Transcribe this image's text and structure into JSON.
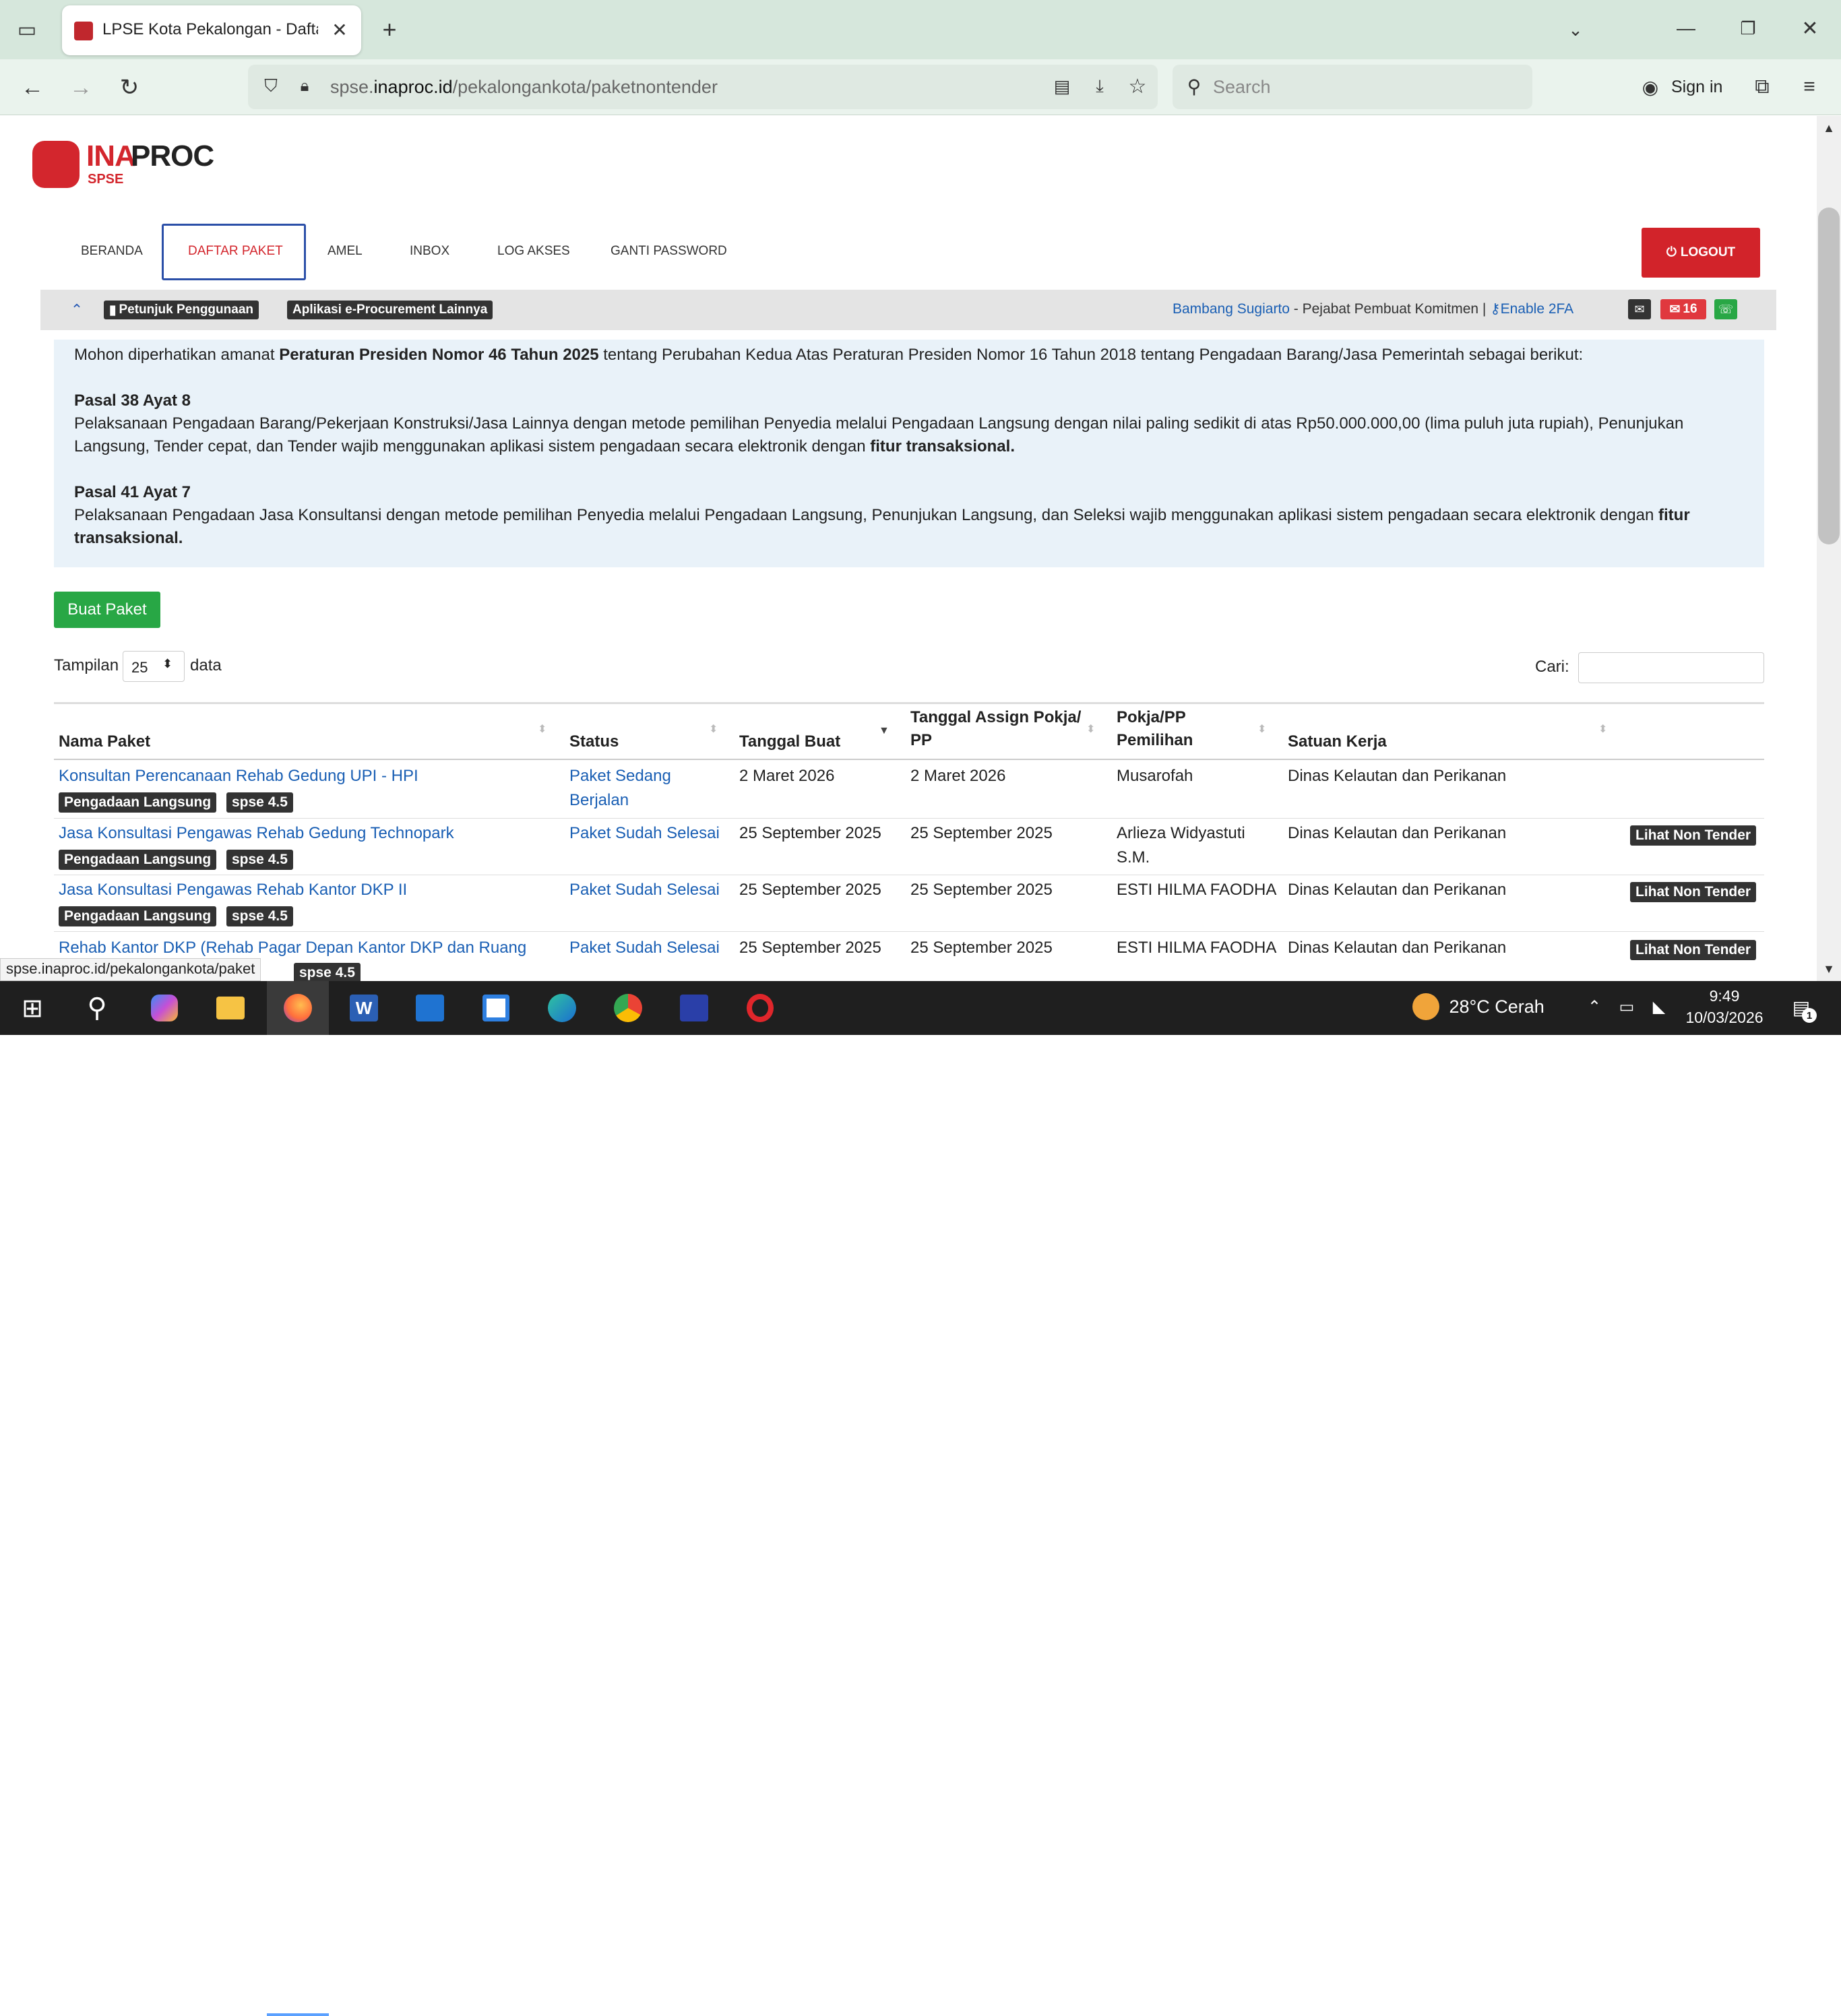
{
  "browser": {
    "tab_title": "LPSE Kota Pekalongan - Daftar Paket",
    "url_host": "spse.",
    "url_domain": "inaproc.id",
    "url_path": "/pekalongankota/paketnontender",
    "search_placeholder": "Search",
    "sign_in": "Sign in",
    "status_url": "spse.inaproc.id/pekalongankota/paket"
  },
  "logo": {
    "ina": "INA",
    "proc": "PROC",
    "sub": "SPSE"
  },
  "menu": [
    "BERANDA",
    "DAFTAR PAKET",
    "AMEL",
    "INBOX",
    "LOG AKSES",
    "GANTI PASSWORD"
  ],
  "logout": "LOGOUT",
  "infobar": {
    "petunjuk": "Petunjuk Penggunaan",
    "aplikasi": "Aplikasi e-Procurement Lainnya",
    "user": "Bambang Sugiarto",
    "role": " - Pejabat Pembuat Komitmen | ",
    "enable2fa": "Enable 2FA",
    "mail_count": "16"
  },
  "notice": {
    "intro_a": "Mohon diperhatikan amanat ",
    "intro_b": "Peraturan Presiden Nomor 46 Tahun 2025",
    "intro_c": " tentang Perubahan Kedua Atas Peraturan Presiden Nomor 16 Tahun 2018 tentang Pengadaan Barang/Jasa Pemerintah sebagai berikut:",
    "p38_title": "Pasal 38 Ayat 8",
    "p38_line1": "Pelaksanaan Pengadaan Barang/Pekerjaan Konstruksi/Jasa Lainnya dengan metode pemilihan Penyedia melalui Pengadaan Langsung dengan nilai paling sedikit di atas Rp50.000.000,00 (lima puluh juta rupiah), Penunjukan",
    "p38_line2a": "Langsung, Tender cepat, dan Tender wajib menggunakan aplikasi sistem pengadaan secara elektronik dengan ",
    "p38_line2b": "fitur transaksional.",
    "p41_title": "Pasal 41 Ayat 7",
    "p41_line1a": "Pelaksanaan Pengadaan Jasa Konsultansi dengan metode pemilihan Penyedia melalui Pengadaan Langsung, Penunjukan Langsung, dan Seleksi wajib menggunakan aplikasi sistem pengadaan secara elektronik dengan ",
    "p41_line1b": "fitur",
    "p41_line2": "transaksional."
  },
  "buat_paket": "Buat Paket",
  "tampilan": {
    "label": "Tampilan",
    "value": "25",
    "suffix": "data"
  },
  "cari": "Cari:",
  "table": {
    "headers": [
      "Nama Paket",
      "Status",
      "Tanggal Buat",
      "Tanggal Assign Pokja/",
      "PP",
      "Pokja/PP",
      "Pemilihan",
      "Satuan Kerja"
    ],
    "rows": [
      {
        "nama": "Konsultan Perencanaan Rehab Gedung UPI - HPI",
        "metode": "Pengadaan Langsung",
        "versi": "spse 4.5",
        "status1": "Paket Sedang",
        "status2": "Berjalan",
        "tgl_buat": "2 Maret 2026",
        "tgl_assign": "2 Maret 2026",
        "pokja1": "Musarofah",
        "pokja2": "",
        "satker": "Dinas Kelautan dan Perikanan",
        "aksi": ""
      },
      {
        "nama": "Jasa Konsultasi Pengawas Rehab Gedung Technopark",
        "metode": "Pengadaan Langsung",
        "versi": "spse 4.5",
        "status1": "Paket Sudah Selesai",
        "status2": "",
        "tgl_buat": "25 September 2025",
        "tgl_assign": "25 September 2025",
        "pokja1": "Arlieza Widyastuti",
        "pokja2": "S.M.",
        "satker": "Dinas Kelautan dan Perikanan",
        "aksi": "Lihat Non Tender"
      },
      {
        "nama": "Jasa Konsultasi Pengawas Rehab Kantor DKP II",
        "metode": "Pengadaan Langsung",
        "versi": "spse 4.5",
        "status1": "Paket Sudah Selesai",
        "status2": "",
        "tgl_buat": "25 September 2025",
        "tgl_assign": "25 September 2025",
        "pokja1": "ESTI HILMA FAODHA",
        "pokja2": "",
        "satker": "Dinas Kelautan dan Perikanan",
        "aksi": "Lihat Non Tender"
      },
      {
        "nama": "Rehab Kantor DKP (Rehab Pagar Depan Kantor DKP dan Ruang",
        "metode": "",
        "versi": "spse 4.5",
        "status1": "Paket Sudah Selesai",
        "status2": "",
        "tgl_buat": "25 September 2025",
        "tgl_assign": "25 September 2025",
        "pokja1": "ESTI HILMA FAODHA",
        "pokja2": "",
        "satker": "Dinas Kelautan dan Perikanan",
        "aksi": "Lihat Non Tender"
      }
    ]
  },
  "taskbar": {
    "weather": "28°C  Cerah",
    "time": "9:49",
    "date": "10/03/2026",
    "notif": "1"
  }
}
